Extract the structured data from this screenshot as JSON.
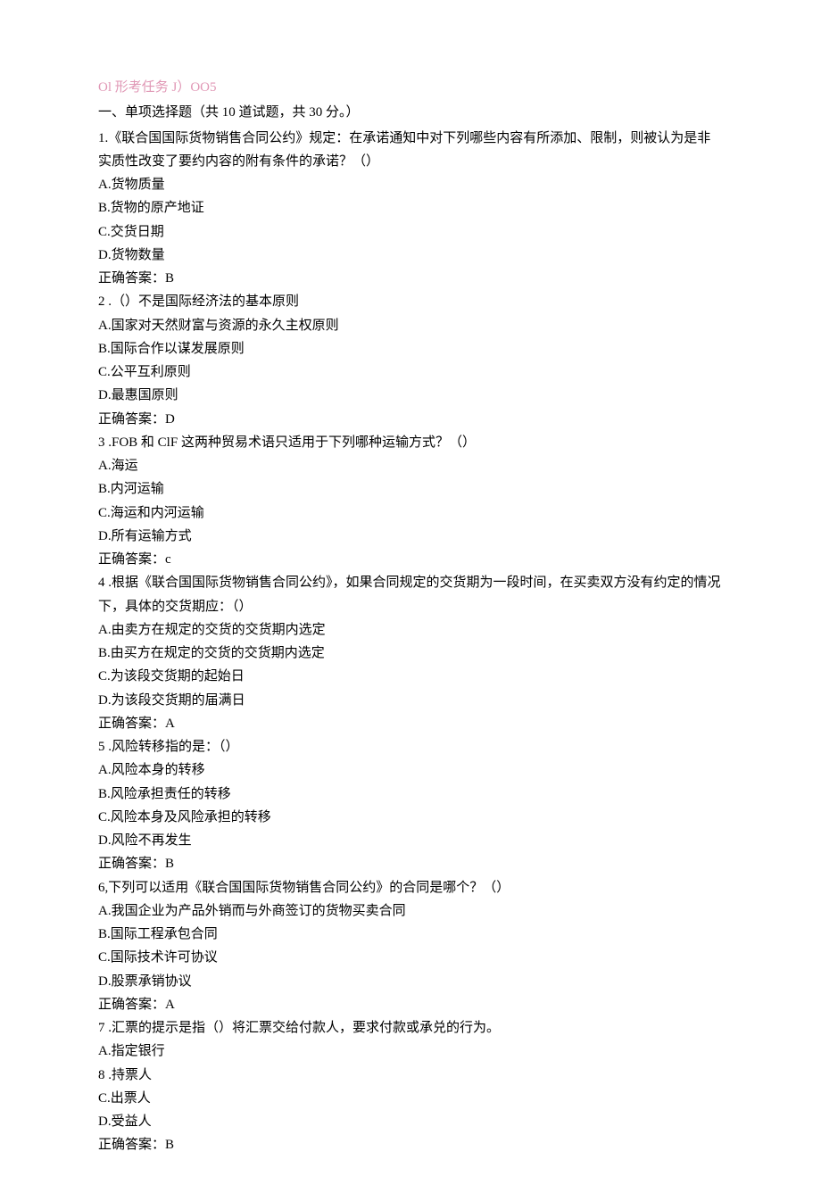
{
  "header": "Ol 形考任务 J）OO5",
  "sectionTitle": "一、单项选择题（共 10 道试题，共 30 分。）",
  "questions": [
    {
      "text": "1.《联合国国际货物销售合同公约》规定：在承诺通知中对下列哪些内容有所添加、限制，则被认为是非实质性改变了要约内容的附有条件的承诺？（）",
      "options": [
        "A.货物质量",
        "B.货物的原产地证",
        "C.交货日期",
        "D.货物数量"
      ],
      "answer": "正确答案：B"
    },
    {
      "text": "2   .（）不是国际经济法的基本原则",
      "options": [
        "A.国家对天然财富与资源的永久主权原则",
        "B.国际合作以谋发展原则",
        "C.公平互利原则",
        "D.最惠国原则"
      ],
      "answer": "正确答案：D"
    },
    {
      "text": "3   .FOB 和 ClF 这两种贸易术语只适用于下列哪种运输方式？（）",
      "options": [
        "A.海运",
        "B.内河运输",
        "C.海运和内河运输",
        "D.所有运输方式"
      ],
      "answer": "正确答案：c"
    },
    {
      "text": "4    .根据《联合国国际货物销售合同公约》，如果合同规定的交货期为一段时间，在买卖双方没有约定的情况下，具体的交货期应：（）",
      "options": [
        "A.由卖方在规定的交货的交货期内选定",
        "B.由买方在规定的交货的交货期内选定",
        "C.为该段交货期的起始日",
        "D.为该段交货期的届满日"
      ],
      "answer": "正确答案：A"
    },
    {
      "text": "5   .风险转移指的是：（）",
      "options": [
        "A.风险本身的转移",
        "B.风险承担责任的转移",
        "C.风险本身及风险承担的转移",
        "D.风险不再发生"
      ],
      "answer": "正确答案：B"
    },
    {
      "text": "6,下列可以适用《联合国国际货物销售合同公约》的合同是哪个？（）",
      "options": [
        "A.我国企业为产品外销而与外商签订的货物买卖合同",
        "B.国际工程承包合同",
        "C.国际技术许可协议",
        "D.股票承销协议"
      ],
      "answer": "正确答案：A"
    },
    {
      "text": "7   .汇票的提示是指（）将汇票交给付款人，要求付款或承兑的行为。",
      "options": [
        "A.指定银行",
        "8    .持票人",
        "C.出票人",
        "D.受益人"
      ],
      "answer": "正确答案：B"
    }
  ]
}
